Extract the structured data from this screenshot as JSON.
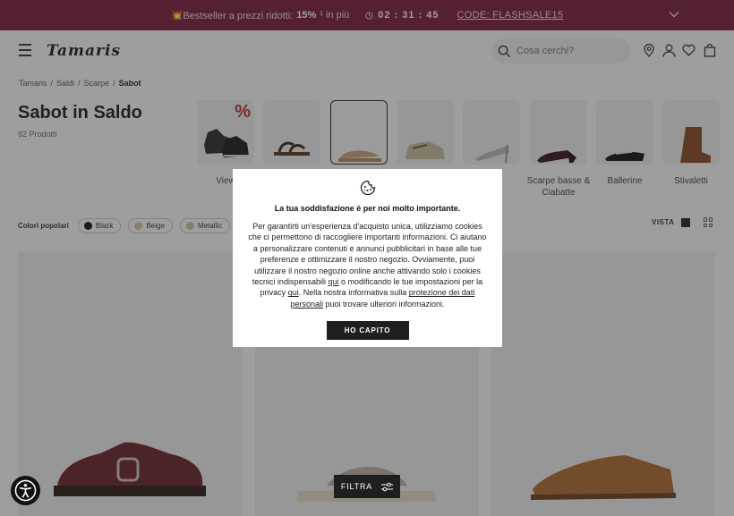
{
  "promo": {
    "prefix": "💥Bestseller a prezzi ridotti: ",
    "discount": "15%",
    "suffix": "¹ in più",
    "countdown": "02 : 31 : 45",
    "code": "CODE: FLASHSALE15"
  },
  "header": {
    "logo": "Tamaris",
    "search_placeholder": "Cosa cerchi?"
  },
  "breadcrumb": [
    "Tamaris",
    "Saldi",
    "Scarpe",
    "Sabot"
  ],
  "page": {
    "title": "Sabot in Saldo",
    "count": "92 Prodotti"
  },
  "categories": [
    {
      "label": "View all",
      "visible_label": "View"
    },
    {
      "label": "Sandali"
    },
    {
      "label": "Sabot"
    },
    {
      "label": "Sneakers"
    },
    {
      "label": "Décolleté",
      "visible_label": "te"
    },
    {
      "label": "Scarpe basse & Ciabatte",
      "visible_label": "Scarpe basse & Ciabatte"
    },
    {
      "label": "Ballerine",
      "visible_label": "Ballerine"
    },
    {
      "label": "Stivaletti",
      "visible_label": "Stivaletti"
    }
  ],
  "filters": {
    "label": "Colori popolari",
    "chips": [
      {
        "label": "Black",
        "color": "#111111"
      },
      {
        "label": "Beige",
        "color": "#d8c7a3"
      },
      {
        "label": "Metallic",
        "color": "#cfc59a"
      }
    ]
  },
  "view": {
    "label": "VISTA"
  },
  "cookie_modal": {
    "title": "La tua soddisfazione è per noi molto importante.",
    "body_1": "Per garantirti un'esperienza d'acquisto unica, utilizziamo cookies che ci permettono di raccogliere importanti informazioni. Ci aiutano a personalizzare contenuti e annunci pubblicitari in base alle tue preferenze e ottimizzare il nostro negozio. Ovviamente, puoi utilizzare il nostro negozio online anche attivando solo i cookies tecnici indispensabili ",
    "link_1": "qui",
    "body_2": " o modificando le tue impostazioni per la privacy ",
    "link_2": "qui",
    "body_3": ". Nella nostra informativa sulla ",
    "link_3": "protezione dei dati personali",
    "body_4": "  puoi trovare ulteriori informazioni.",
    "button": "HO CAPITO"
  },
  "filtra_button": "FILTRA",
  "colors": {
    "promo_bg": "#7a1a3a",
    "button_dark": "#1f1f1f",
    "sale_red": "#c1272d"
  }
}
